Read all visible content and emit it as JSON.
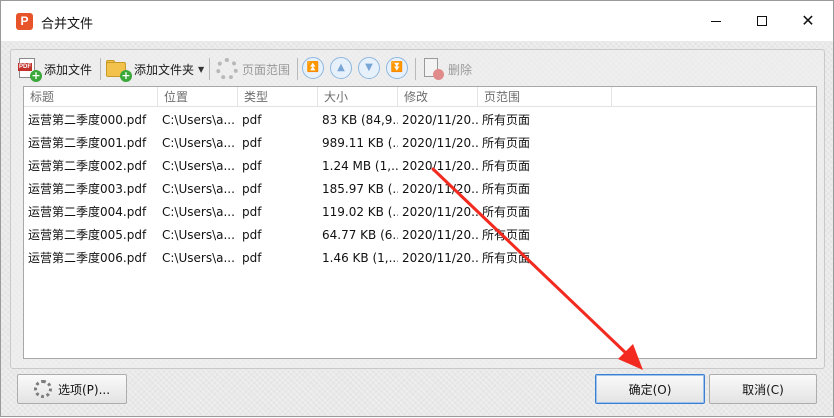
{
  "window": {
    "title": "合并文件",
    "app_icon_letter": "P"
  },
  "toolbar": {
    "add_file": "添加文件",
    "add_folder": "添加文件夹",
    "page_range": "页面范围",
    "delete": "删除"
  },
  "table": {
    "columns": [
      "标题",
      "位置",
      "类型",
      "大小",
      "修改",
      "页范围"
    ],
    "rows": [
      {
        "title": "运营第二季度000.pdf",
        "location": "C:\\Users\\a...",
        "type": "pdf",
        "size": "83 KB (84,9...",
        "modified": "2020/11/20...",
        "range": "所有页面"
      },
      {
        "title": "运营第二季度001.pdf",
        "location": "C:\\Users\\a...",
        "type": "pdf",
        "size": "989.11 KB (...",
        "modified": "2020/11/20...",
        "range": "所有页面"
      },
      {
        "title": "运营第二季度002.pdf",
        "location": "C:\\Users\\a...",
        "type": "pdf",
        "size": "1.24 MB (1,...",
        "modified": "2020/11/20...",
        "range": "所有页面"
      },
      {
        "title": "运营第二季度003.pdf",
        "location": "C:\\Users\\a...",
        "type": "pdf",
        "size": "185.97 KB (...",
        "modified": "2020/11/20...",
        "range": "所有页面"
      },
      {
        "title": "运营第二季度004.pdf",
        "location": "C:\\Users\\a...",
        "type": "pdf",
        "size": "119.02 KB (...",
        "modified": "2020/11/20...",
        "range": "所有页面"
      },
      {
        "title": "运营第二季度005.pdf",
        "location": "C:\\Users\\a...",
        "type": "pdf",
        "size": "64.77 KB (6...",
        "modified": "2020/11/20...",
        "range": "所有页面"
      },
      {
        "title": "运营第二季度006.pdf",
        "location": "C:\\Users\\a...",
        "type": "pdf",
        "size": "1.46 KB (1,...",
        "modified": "2020/11/20...",
        "range": "所有页面"
      }
    ]
  },
  "buttons": {
    "options": "选项(P)...",
    "ok": "确定(O)",
    "cancel": "取消(C)"
  },
  "colors": {
    "accent_arrow": "#f22a1f",
    "primary_border": "#3c7fd1"
  }
}
